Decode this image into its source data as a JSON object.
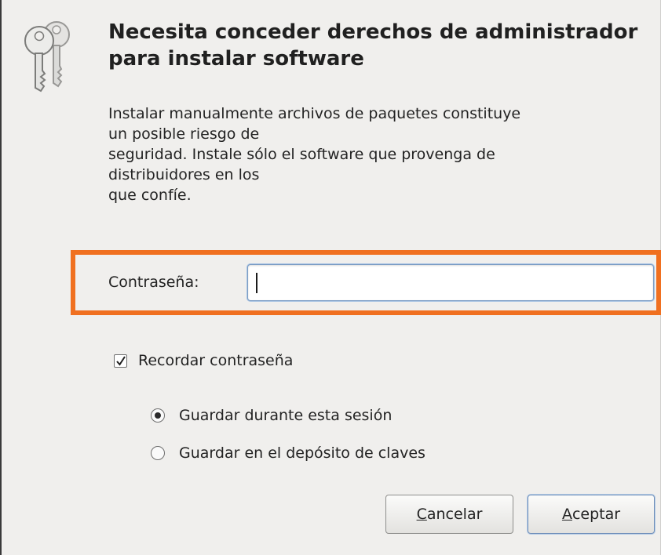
{
  "dialog": {
    "title": "Necesita conceder derechos de administrador para instalar software",
    "description": "Instalar manualmente archivos de paquetes constituye\nun posible riesgo de\nseguridad. Instale sólo el software que provenga de\ndistribuidores en los\nque confíe.",
    "icon": "keys-icon"
  },
  "password": {
    "label": "Contraseña:",
    "value": "",
    "placeholder": ""
  },
  "remember": {
    "label": "Recordar contraseña",
    "checked": true
  },
  "storage_options": [
    {
      "label": "Guardar durante esta sesión",
      "selected": true
    },
    {
      "label": "Guardar en el depósito de claves",
      "selected": false
    }
  ],
  "buttons": {
    "cancel": {
      "mnemonic": "C",
      "rest": "ancelar"
    },
    "accept": {
      "mnemonic": "A",
      "rest": "ceptar"
    }
  },
  "colors": {
    "highlight": "#f07020",
    "background": "#f0efed",
    "focus_border": "#7a9cc4"
  }
}
